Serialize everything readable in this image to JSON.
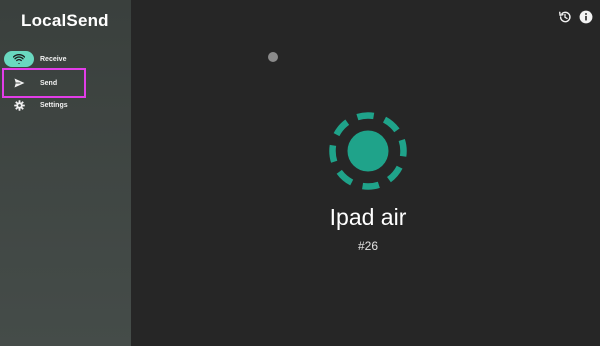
{
  "app": {
    "title": "LocalSend"
  },
  "nav": {
    "items": [
      {
        "label": "Receive",
        "icon": "wifi-icon",
        "active": true
      },
      {
        "label": "Send",
        "icon": "send-icon",
        "active": false
      },
      {
        "label": "Settings",
        "icon": "gear-icon",
        "active": false
      }
    ]
  },
  "header": {
    "history_icon": "history-icon",
    "info_icon": "info-icon"
  },
  "device": {
    "name": "Ipad air",
    "id": "#26"
  },
  "colors": {
    "accent": "#1fa38a",
    "accent_light": "#6ad8c0",
    "sidebar_bg": "#3f4643",
    "main_bg": "#262626",
    "highlight": "#e23de8"
  }
}
